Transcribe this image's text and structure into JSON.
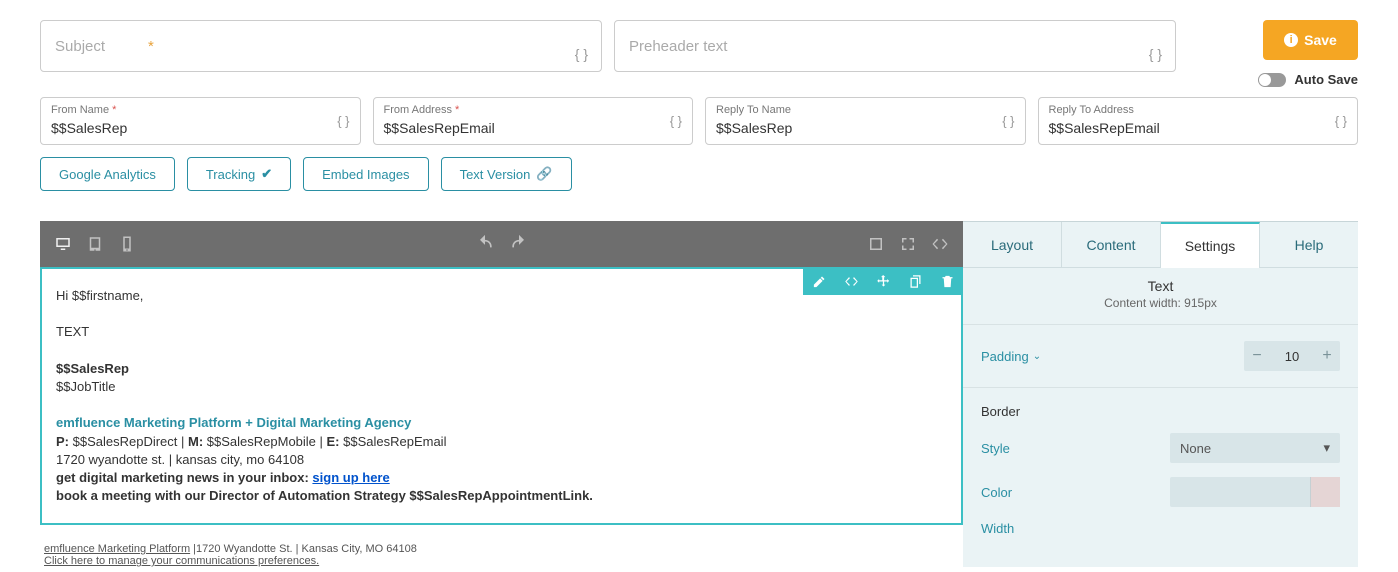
{
  "topFields": {
    "subjectPlaceholder": "Subject",
    "preheaderPlaceholder": "Preheader text"
  },
  "save": {
    "label": "Save",
    "autoSave": "Auto Save"
  },
  "fromFields": {
    "fromName": {
      "label": "From Name",
      "value": "$$SalesRep"
    },
    "fromAddress": {
      "label": "From Address",
      "value": "$$SalesRepEmail"
    },
    "replyName": {
      "label": "Reply To Name",
      "value": "$$SalesRep"
    },
    "replyAddress": {
      "label": "Reply To Address",
      "value": "$$SalesRepEmail"
    }
  },
  "buttons": {
    "ga": "Google Analytics",
    "tracking": "Tracking",
    "embed": "Embed Images",
    "textVersion": "Text Version"
  },
  "editor": {
    "greeting": "Hi $$firstname,",
    "body": "TEXT",
    "salesRep": "$$SalesRep",
    "jobTitle": "$$JobTitle",
    "company": "emfluence Marketing Platform + Digital Marketing Agency",
    "phoneLine": {
      "pLabel": "P:",
      "pVal": " $$SalesRepDirect | ",
      "mLabel": "M:",
      "mVal": " $$SalesRepMobile | ",
      "eLabel": "E:",
      "eVal": " $$SalesRepEmail"
    },
    "address": "1720 wyandotte st. | kansas city, mo 64108",
    "newsLine": "get digital marketing news in your inbox: ",
    "signupLink": "sign up here",
    "meeting": "book a meeting with our Director of Automation Strategy $$SalesRepAppointmentLink."
  },
  "footer": {
    "brand": "emfluence Marketing Platform",
    "addr": " |1720 Wyandotte St. | Kansas City, MO 64108",
    "prefs": "Click here to manage your communications preferences."
  },
  "panel": {
    "tabs": {
      "layout": "Layout",
      "content": "Content",
      "settings": "Settings",
      "help": "Help"
    },
    "header": {
      "title": "Text",
      "sub": "Content width: 915px"
    },
    "padding": {
      "label": "Padding",
      "value": "10"
    },
    "border": {
      "section": "Border",
      "styleLabel": "Style",
      "styleValue": "None",
      "colorLabel": "Color",
      "widthLabel": "Width"
    }
  }
}
